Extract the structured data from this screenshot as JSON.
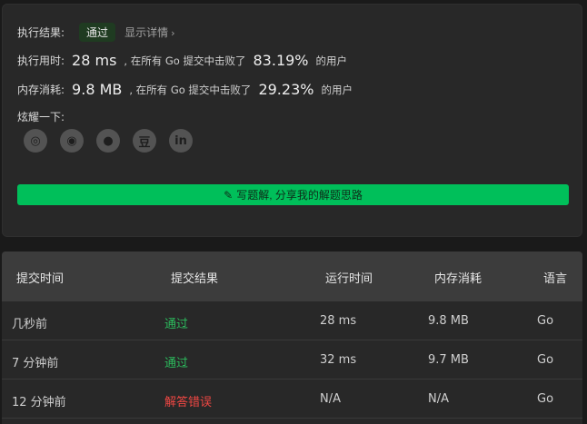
{
  "result": {
    "label": "执行结果:",
    "status": "通过",
    "detail_link": "显示详情",
    "detail_chevron": "›",
    "runtime": {
      "label": "执行用时:",
      "value": "28 ms",
      "mid": ", 在所有 Go 提交中击败了",
      "percent": "83.19%",
      "tail": "的用户"
    },
    "memory": {
      "label": "内存消耗:",
      "value": "9.8 MB",
      "mid": ", 在所有 Go 提交中击败了",
      "percent": "29.23%",
      "tail": "的用户"
    },
    "share_label": "炫耀一下:",
    "share_icons": [
      {
        "name": "wechat-icon",
        "glyph": "◎"
      },
      {
        "name": "weibo-icon",
        "glyph": "◉"
      },
      {
        "name": "qq-icon",
        "glyph": "●"
      },
      {
        "name": "douban-icon",
        "glyph": "豆"
      },
      {
        "name": "linkedin-icon",
        "glyph": "in"
      }
    ],
    "write_button": "写题解, 分享我的解题思路"
  },
  "table": {
    "headers": [
      "提交时间",
      "提交结果",
      "运行时间",
      "内存消耗",
      "语言"
    ],
    "rows": [
      {
        "time": "几秒前",
        "result": "通过",
        "status": "ok",
        "runtime": "28 ms",
        "memory": "9.8 MB",
        "lang": "Go"
      },
      {
        "time": "7 分钟前",
        "result": "通过",
        "status": "ok",
        "runtime": "32 ms",
        "memory": "9.7 MB",
        "lang": "Go"
      },
      {
        "time": "12 分钟前",
        "result": "解答错误",
        "status": "err",
        "runtime": "N/A",
        "memory": "N/A",
        "lang": "Go"
      }
    ]
  },
  "colors": {
    "accent": "#00bf5a",
    "success": "#2cbb5d",
    "error": "#ef4743"
  }
}
